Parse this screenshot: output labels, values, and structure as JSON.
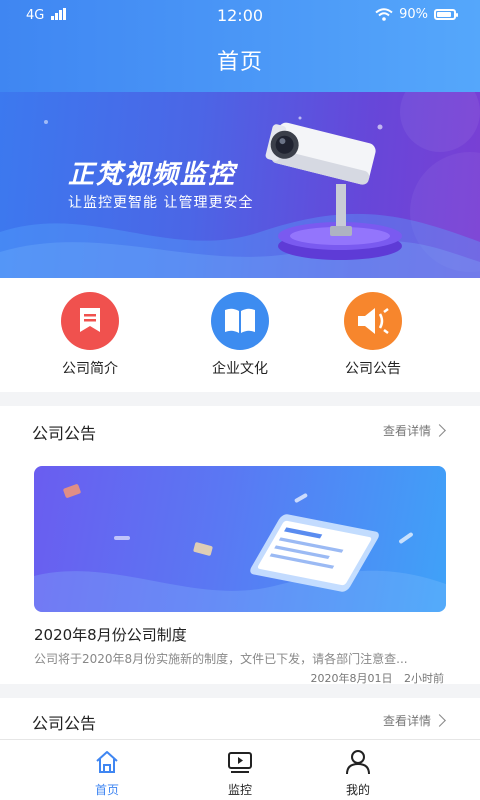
{
  "status_bar": {
    "network": "4G",
    "time": "12:00",
    "battery": "90%"
  },
  "header": {
    "title": "首页"
  },
  "banner": {
    "headline": "正梵视频监控",
    "subtitle": "让监控更智能  让管理更安全"
  },
  "quick_links": [
    {
      "label": "公司简介",
      "icon": "document-icon",
      "color": "#f0514e"
    },
    {
      "label": "企业文化",
      "icon": "book-icon",
      "color": "#3d8cf0"
    },
    {
      "label": "公司公告",
      "icon": "megaphone-icon",
      "color": "#f7862d"
    }
  ],
  "sections": [
    {
      "title": "公司公告",
      "more_label": "查看详情",
      "news": {
        "title": "2020年8月份公司制度",
        "summary": "公司将于2020年8月份实施新的制度，文件已下发，请各部门注意查...",
        "date": "2020年8月01日",
        "ago": "2小时前"
      }
    },
    {
      "title": "公司公告",
      "more_label": "查看详情"
    }
  ],
  "tabbar": [
    {
      "label": "首页",
      "icon": "home-icon",
      "active": true
    },
    {
      "label": "监控",
      "icon": "video-icon",
      "active": false
    },
    {
      "label": "我的",
      "icon": "user-icon",
      "active": false
    }
  ],
  "colors": {
    "accent": "#3f86f2",
    "text": "#222222",
    "muted": "#888888"
  }
}
